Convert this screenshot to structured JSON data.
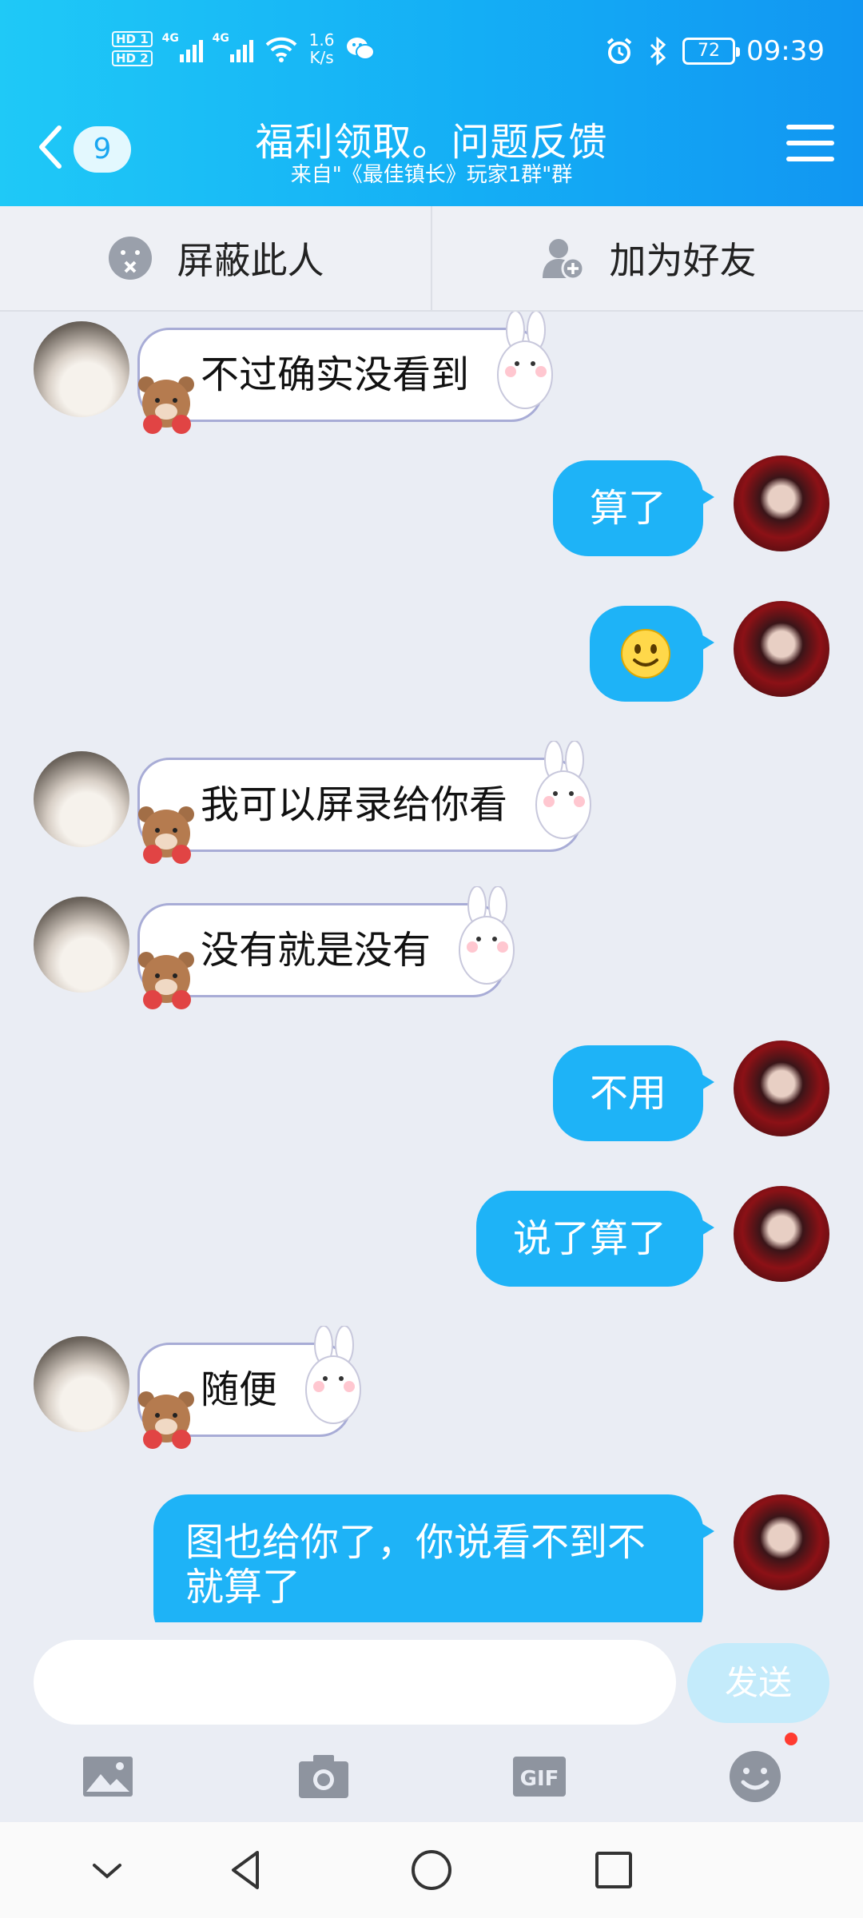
{
  "status_bar": {
    "hd1": "HD 1",
    "hd2": "HD 2",
    "net1": "4G",
    "net2": "4G",
    "speed_value": "1.6",
    "speed_unit": "K/s",
    "battery": "72",
    "time": "09:39"
  },
  "header": {
    "back_count": "9",
    "title": "福利领取。问题反馈",
    "subtitle": "来自\"《最佳镇长》玩家1群\"群"
  },
  "actions": {
    "block": "屏蔽此人",
    "add_friend": "加为好友"
  },
  "messages": [
    {
      "side": "left",
      "text": "不过确实没看到"
    },
    {
      "side": "right",
      "text": "算了"
    },
    {
      "side": "right",
      "text": "smile-emoji"
    },
    {
      "side": "left",
      "text": "我可以屏录给你看"
    },
    {
      "side": "left",
      "text": "没有就是没有"
    },
    {
      "side": "right",
      "text": "不用"
    },
    {
      "side": "right",
      "text": "说了算了"
    },
    {
      "side": "left",
      "text": "随便"
    },
    {
      "side": "right",
      "text_line1": "图也给你了，你说看不到不",
      "text_line2": "就算了"
    }
  ],
  "input": {
    "placeholder": "",
    "send_label": "发送"
  },
  "tools": {
    "gif_label": "GIF"
  },
  "colors": {
    "header_start": "#1fc9f7",
    "header_end": "#1196f2",
    "bubble_blue": "#1eb3f7",
    "chat_bg": "#eaedf4"
  }
}
